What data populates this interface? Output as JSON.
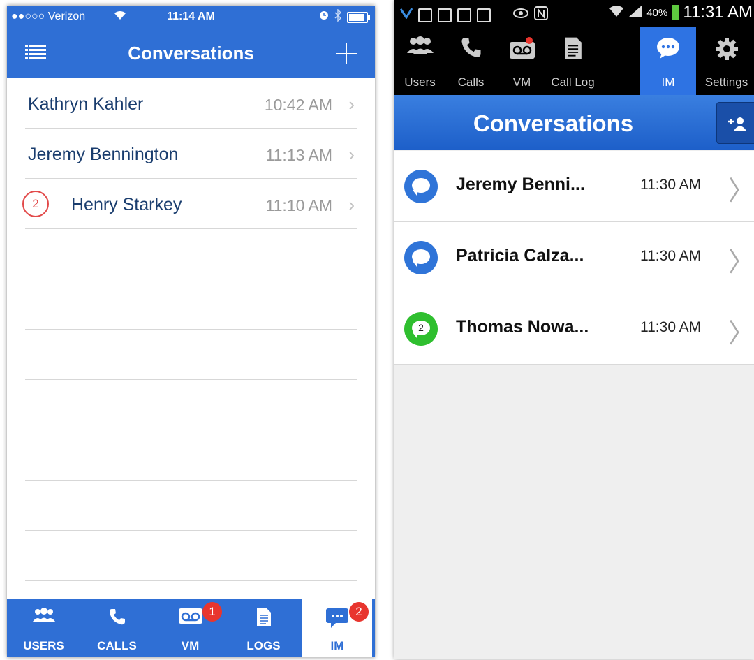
{
  "colors": {
    "ios_blue": "#2f6fd5",
    "android_blue": "#2e73e3",
    "badge_red": "#e8352e",
    "bubble_blue": "#2f74d8",
    "bubble_green": "#2fbf2f"
  },
  "ios": {
    "status": {
      "carrier": "●●○○○ Verizon",
      "time": "11:14 AM"
    },
    "navbar": {
      "title": "Conversations",
      "menu_icon": "list-icon",
      "add_icon": "plus-icon"
    },
    "conversations": [
      {
        "name": "Kathryn Kahler",
        "time": "10:42 AM",
        "unread": ""
      },
      {
        "name": "Jeremy Bennington",
        "time": "11:13 AM",
        "unread": ""
      },
      {
        "name": "Henry Starkey",
        "time": "11:10 AM",
        "unread": "2"
      }
    ],
    "tabs": [
      {
        "label": "USERS",
        "icon": "users-icon",
        "badge": ""
      },
      {
        "label": "CALLS",
        "icon": "phone-icon",
        "badge": ""
      },
      {
        "label": "VM",
        "icon": "voicemail-icon",
        "badge": "1"
      },
      {
        "label": "LOGS",
        "icon": "document-icon",
        "badge": ""
      },
      {
        "label": "IM",
        "icon": "chat-icon",
        "badge": "2"
      }
    ],
    "active_tab": "IM"
  },
  "android": {
    "status": {
      "battery": "40%",
      "time": "11:31 AM"
    },
    "tabs": [
      {
        "label": "Users",
        "icon": "users-icon"
      },
      {
        "label": "Calls",
        "icon": "phone-icon"
      },
      {
        "label": "VM",
        "icon": "voicemail-icon"
      },
      {
        "label": "Call Log",
        "icon": "document-icon"
      },
      {
        "label": "IM",
        "icon": "chat-icon"
      },
      {
        "label": "Settings",
        "icon": "gear-icon"
      }
    ],
    "active_tab": "IM",
    "header": {
      "title": "Conversations",
      "add_icon": "add-user-icon"
    },
    "conversations": [
      {
        "name": "Jeremy Benni...",
        "time": "11:30 AM",
        "unread": ""
      },
      {
        "name": "Patricia Calza...",
        "time": "11:30 AM",
        "unread": ""
      },
      {
        "name": "Thomas Nowa...",
        "time": "11:30 AM",
        "unread": "2"
      }
    ]
  }
}
